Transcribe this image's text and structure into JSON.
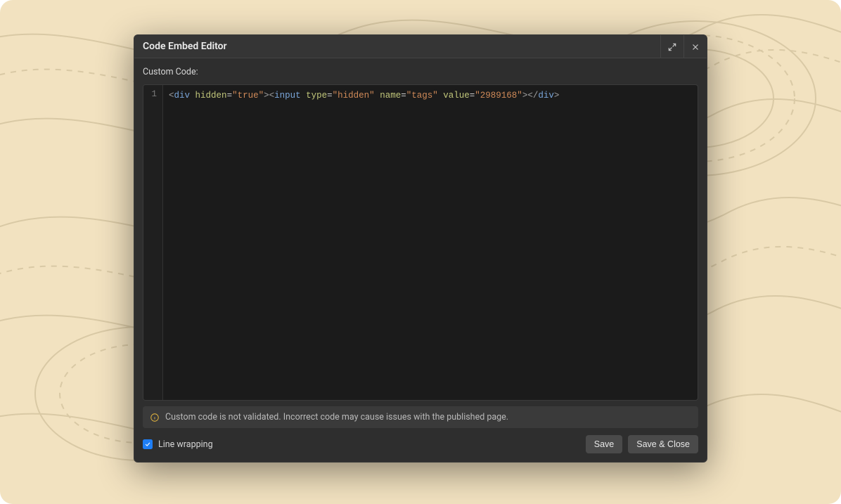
{
  "modal": {
    "title": "Code Embed Editor",
    "field_label": "Custom Code:",
    "line_number": "1",
    "code_tokens": [
      {
        "t": "bracket",
        "v": "<"
      },
      {
        "t": "tag",
        "v": "div"
      },
      {
        "t": "plain",
        "v": " "
      },
      {
        "t": "attr",
        "v": "hidden"
      },
      {
        "t": "eq",
        "v": "="
      },
      {
        "t": "str",
        "v": "\"true\""
      },
      {
        "t": "bracket",
        "v": "><"
      },
      {
        "t": "tag",
        "v": "input"
      },
      {
        "t": "plain",
        "v": " "
      },
      {
        "t": "attr",
        "v": "type"
      },
      {
        "t": "eq",
        "v": "="
      },
      {
        "t": "str",
        "v": "\"hidden\""
      },
      {
        "t": "plain",
        "v": " "
      },
      {
        "t": "attr",
        "v": "name"
      },
      {
        "t": "eq",
        "v": "="
      },
      {
        "t": "str",
        "v": "\"tags\""
      },
      {
        "t": "plain",
        "v": " "
      },
      {
        "t": "attr",
        "v": "value"
      },
      {
        "t": "eq",
        "v": "="
      },
      {
        "t": "str",
        "v": "\"2989168\""
      },
      {
        "t": "bracket",
        "v": "></"
      },
      {
        "t": "tag",
        "v": "div"
      },
      {
        "t": "bracket",
        "v": ">"
      }
    ],
    "info_text": "Custom code is not validated. Incorrect code may cause issues with the published page.",
    "line_wrapping_label": "Line wrapping",
    "line_wrapping_checked": true,
    "save_label": "Save",
    "save_close_label": "Save & Close"
  },
  "colors": {
    "bg": "#f2e2c0",
    "modal_bg": "#2e2e2e",
    "editor_bg": "#1b1b1b",
    "accent_warn": "#e8b93f",
    "accent_check": "#1e7ef5"
  }
}
